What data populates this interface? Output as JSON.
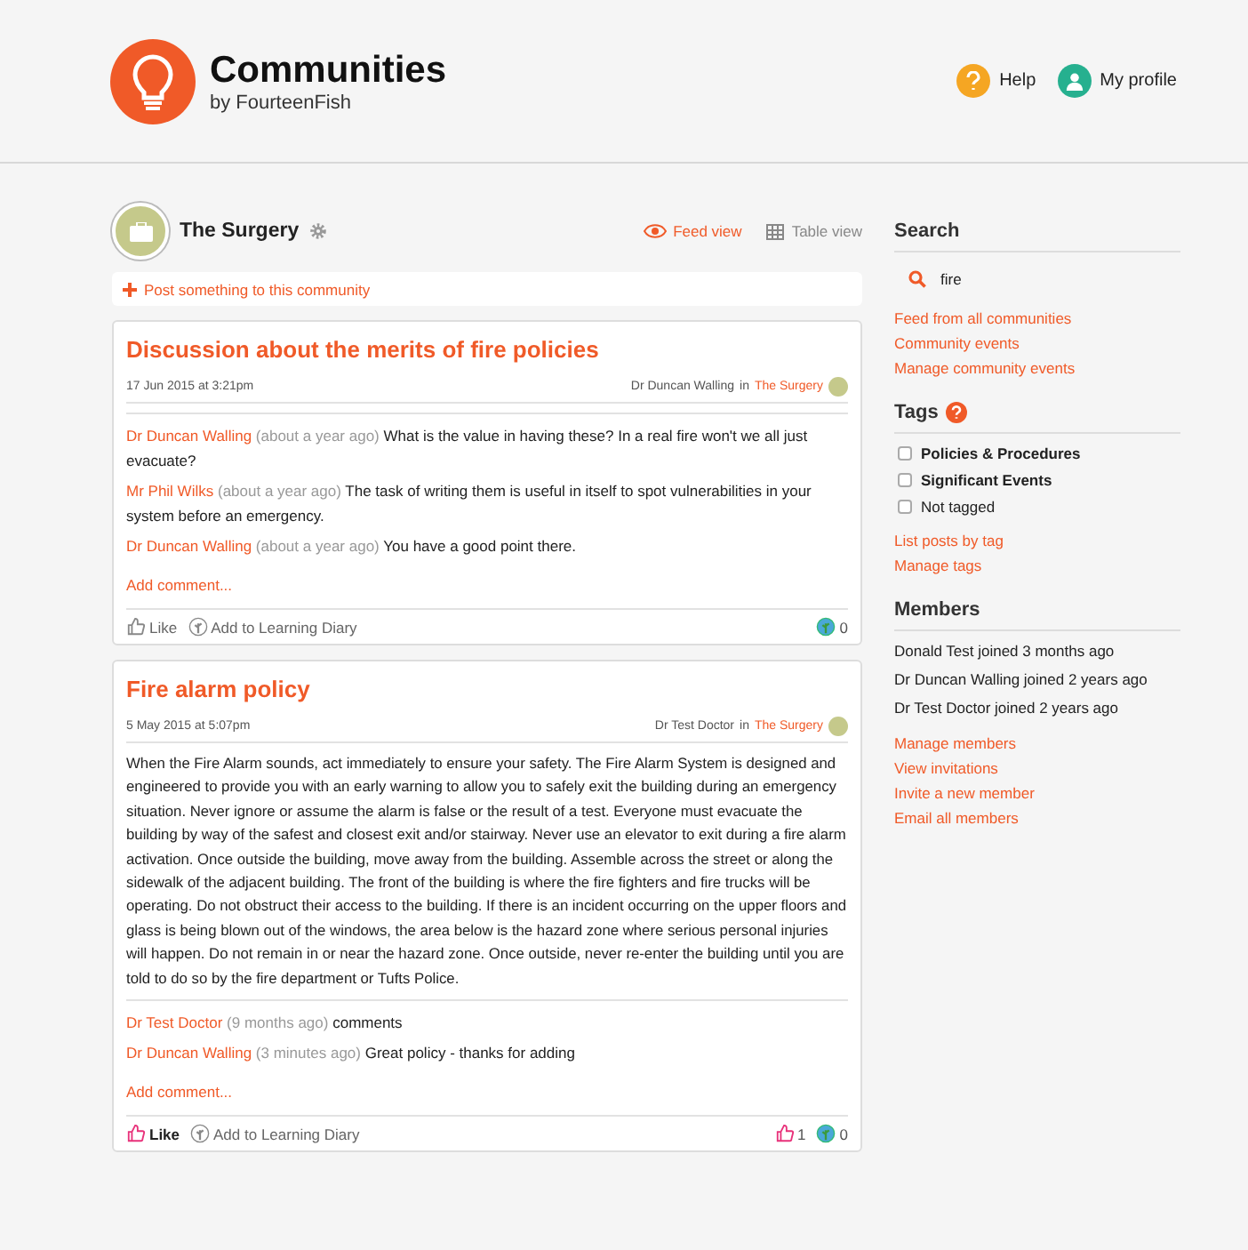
{
  "header": {
    "title": "Communities",
    "subtitle": "by FourteenFish",
    "links": [
      {
        "kind": "help",
        "label": "Help"
      },
      {
        "kind": "profile",
        "label": "My profile"
      }
    ]
  },
  "community": {
    "name": "The Surgery",
    "views": [
      {
        "kind": "feed",
        "label": "Feed view",
        "selected": true
      },
      {
        "kind": "table",
        "label": "Table view",
        "selected": false
      }
    ],
    "post_prompt": "Post something to this community"
  },
  "posts": [
    {
      "title": "Discussion about the merits of fire policies",
      "date": "17 Jun 2015 at 3:21pm",
      "author": "Dr Duncan Walling",
      "in": "in",
      "community": "The Surgery",
      "comments": [
        {
          "author": "Dr Duncan Walling",
          "time": "(about a year ago)",
          "text": "What is the value in having these? In a real fire won't we all just evacuate?"
        },
        {
          "author": "Mr Phil Wilks",
          "time": "(about a year ago)",
          "text": "The task of writing them is useful in itself to spot vulnerabilities in your system before an emergency."
        },
        {
          "author": "Dr Duncan Walling",
          "time": "(about a year ago)",
          "text": "You have a good point there."
        }
      ],
      "add_comment": "Add comment...",
      "like": "Like",
      "liked": false,
      "diary": "Add to Learning Diary",
      "diary_count": "0"
    },
    {
      "title": "Fire alarm policy",
      "date": "5 May 2015 at 5:07pm",
      "author": "Dr Test Doctor",
      "in": "in",
      "community": "The Surgery",
      "body": "When the Fire Alarm sounds, act immediately to ensure your safety. The Fire Alarm System is designed and engineered to provide you with an early warning to allow you to safely exit the building during an emergency situation. Never ignore or assume the alarm is false or the result of a test. Everyone must evacuate the building by way of the safest and closest exit and/or stairway. Never use an elevator to exit during a fire alarm activation. Once outside the building, move away from the building. Assemble across the street or along the sidewalk of the adjacent building. The front of the building is where the fire fighters and fire trucks will be operating. Do not obstruct their access to the building. If there is an incident occurring on the upper floors and glass is being blown out of the windows, the area below is the hazard zone where serious personal injuries will happen. Do not remain in or near the hazard zone. Once outside, never re-enter the building until you are told to do so by the fire department or Tufts Police.",
      "comments": [
        {
          "author": "Dr Test Doctor",
          "time": "(9 months ago)",
          "text": "comments"
        },
        {
          "author": "Dr Duncan Walling",
          "time": "(3 minutes ago)",
          "text": "Great policy - thanks for adding"
        }
      ],
      "add_comment": "Add comment...",
      "like": "Like",
      "liked": true,
      "diary": "Add to Learning Diary",
      "like_count": "1",
      "diary_count": "0"
    }
  ],
  "sidebar": {
    "search": {
      "heading": "Search",
      "value": "fire"
    },
    "search_links": [
      "Feed from all communities",
      "Community events",
      "Manage community events"
    ],
    "tags": {
      "heading": "Tags",
      "items": [
        {
          "label": "Policies & Procedures",
          "checked": false,
          "bold": true
        },
        {
          "label": "Significant Events",
          "checked": false,
          "bold": true
        },
        {
          "label": "Not tagged",
          "checked": false,
          "bold": false
        }
      ],
      "links": [
        "List posts by tag",
        "Manage tags"
      ]
    },
    "members": {
      "heading": "Members",
      "items": [
        "Donald Test joined 3 months ago",
        "Dr Duncan Walling joined 2 years ago",
        "Dr Test Doctor joined 2 years ago"
      ],
      "links": [
        "Manage members",
        "View invitations",
        "Invite a new member",
        "Email all members"
      ]
    }
  }
}
